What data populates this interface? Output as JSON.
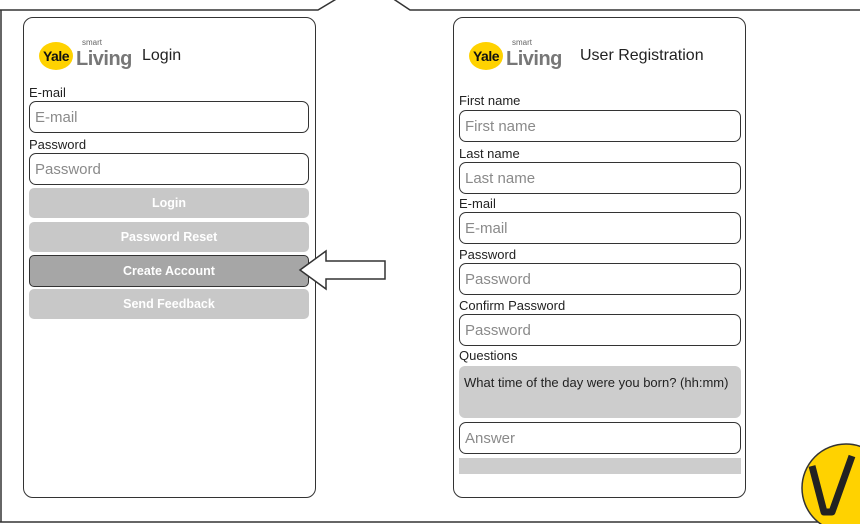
{
  "login": {
    "brand": {
      "yale": "Yale",
      "smart": "smart",
      "living": "Living"
    },
    "title": "Login",
    "email_label": "E-mail",
    "email_placeholder": "E-mail",
    "password_label": "Password",
    "password_placeholder": "Password",
    "buttons": {
      "login": "Login",
      "password_reset": "Password Reset",
      "create_account": "Create Account",
      "send_feedback": "Send Feedback"
    }
  },
  "registration": {
    "brand": {
      "yale": "Yale",
      "smart": "smart",
      "living": "Living"
    },
    "title": "User Registration",
    "first_name_label": "First name",
    "first_name_placeholder": "First name",
    "last_name_label": "Last name",
    "last_name_placeholder": "Last name",
    "email_label": "E-mail",
    "email_placeholder": "E-mail",
    "password_label": "Password",
    "password_placeholder": "Password",
    "confirm_password_label": "Confirm Password",
    "confirm_password_placeholder": "Password",
    "questions_label": "Questions",
    "question_text": "What time of the day were you born? (hh:mm)",
    "answer_placeholder": "Answer"
  },
  "colors": {
    "yale_yellow": "#ffd200",
    "button_gray": "#c8c8c8",
    "button_active": "#a6a6a6"
  },
  "icons": {
    "arrow": "left-arrow-icon",
    "check_logo": "checkmark-logo-icon"
  }
}
